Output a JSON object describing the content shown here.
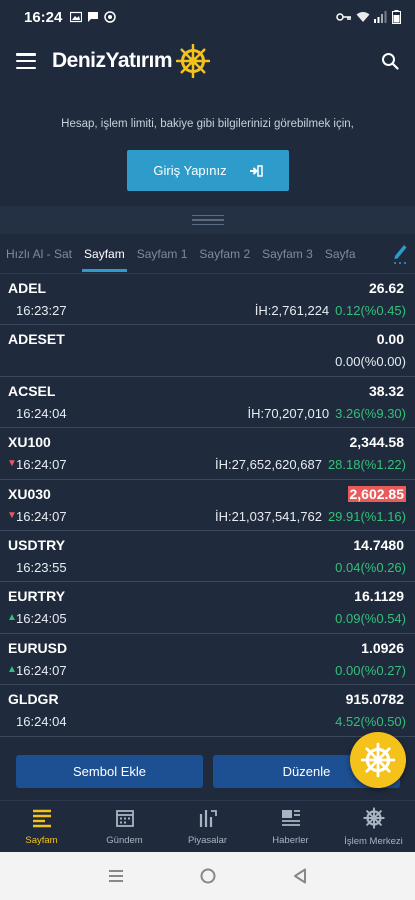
{
  "status_bar": {
    "time": "16:24"
  },
  "app": {
    "title": "DenizYatırım"
  },
  "login": {
    "message": "Hesap, işlem limiti, bakiye gibi bilgilerinizi görebilmek için,",
    "button_label": "Giriş Yapınız"
  },
  "tabs": [
    {
      "label": "Hızlı Al - Sat",
      "active": false
    },
    {
      "label": "Sayfam",
      "active": true
    },
    {
      "label": "Sayfam 1",
      "active": false
    },
    {
      "label": "Sayfam 2",
      "active": false
    },
    {
      "label": "Sayfam 3",
      "active": false
    },
    {
      "label": "Sayfa",
      "active": false
    }
  ],
  "rows": [
    {
      "symbol": "ADEL",
      "price": "26.62",
      "time": "16:23:27",
      "volume": "İH:2,761,224",
      "change": "0.12(%0.45)",
      "arrow": "",
      "flash": false,
      "change_color": "up"
    },
    {
      "symbol": "ADESET",
      "price": "0.00",
      "time": "",
      "volume": "",
      "change": "0.00(%0.00)",
      "arrow": "",
      "flash": false,
      "change_color": "neutral"
    },
    {
      "symbol": "ACSEL",
      "price": "38.32",
      "time": "16:24:04",
      "volume": "İH:70,207,010",
      "change": "3.26(%9.30)",
      "arrow": "",
      "flash": false,
      "change_color": "up"
    },
    {
      "symbol": "XU100",
      "price": "2,344.58",
      "time": "16:24:07",
      "volume": "İH:27,652,620,687",
      "change": "28.18(%1.22)",
      "arrow": "down",
      "flash": false,
      "change_color": "up"
    },
    {
      "symbol": "XU030",
      "price": "2,602.85",
      "time": "16:24:07",
      "volume": "İH:21,037,541,762",
      "change": "29.91(%1.16)",
      "arrow": "down",
      "flash": true,
      "change_color": "up"
    },
    {
      "symbol": "USDTRY",
      "price": "14.7480",
      "time": "16:23:55",
      "volume": "",
      "change": "0.04(%0.26)",
      "arrow": "",
      "flash": false,
      "change_color": "up"
    },
    {
      "symbol": "EURTRY",
      "price": "16.1129",
      "time": "16:24:05",
      "volume": "",
      "change": "0.09(%0.54)",
      "arrow": "up",
      "flash": false,
      "change_color": "up"
    },
    {
      "symbol": "EURUSD",
      "price": "1.0926",
      "time": "16:24:07",
      "volume": "",
      "change": "0.00(%0.27)",
      "arrow": "up",
      "flash": false,
      "change_color": "up"
    },
    {
      "symbol": "GLDGR",
      "price": "915.0782",
      "time": "16:24:04",
      "volume": "",
      "change": "4.52(%0.50)",
      "arrow": "",
      "flash": false,
      "change_color": "up"
    }
  ],
  "actions": {
    "add_symbol": "Sembol Ekle",
    "edit": "Düzenle"
  },
  "bottom_nav": [
    {
      "label": "Sayfam",
      "icon": "page-icon",
      "active": true
    },
    {
      "label": "Gündem",
      "icon": "calendar-icon",
      "active": false
    },
    {
      "label": "Piyasalar",
      "icon": "markets-icon",
      "active": false
    },
    {
      "label": "Haberler",
      "icon": "news-icon",
      "active": false
    },
    {
      "label": "İşlem Merkezi",
      "icon": "helm-icon",
      "active": false
    }
  ],
  "colors": {
    "background": "#1f2a3c",
    "accent": "#2d9ccb",
    "up": "#33c07a",
    "down": "#e85b5b",
    "brand_yellow": "#f5c21b",
    "button_blue": "#1d4f93"
  }
}
